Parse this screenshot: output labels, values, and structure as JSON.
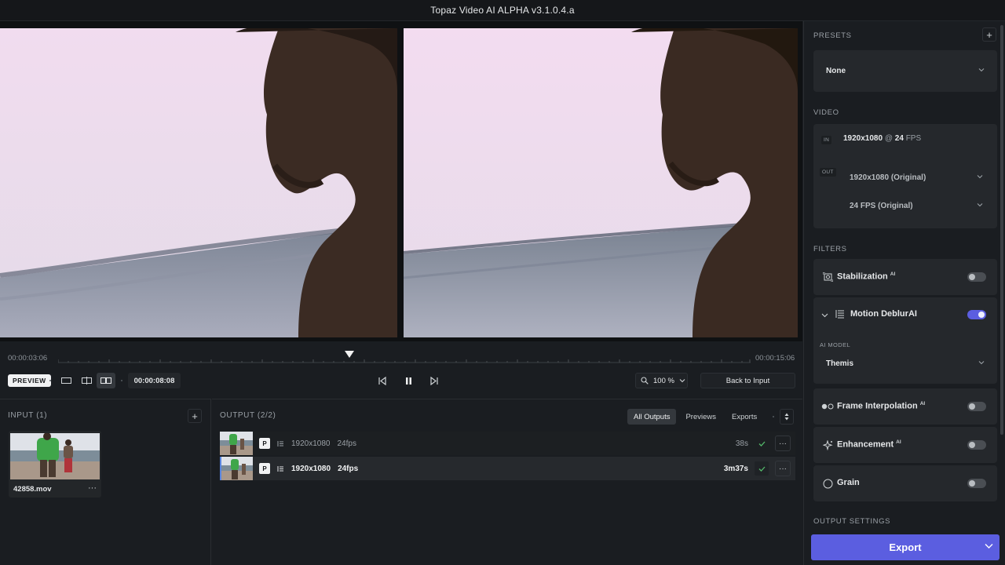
{
  "app": {
    "title": "Topaz Video AI ALPHA  v3.1.0.4.a"
  },
  "timeline": {
    "start_time": "00:00:03:06",
    "end_time": "00:00:15:06"
  },
  "transport": {
    "preview_label": "PREVIEW",
    "timecode": "00:00:08:08",
    "zoom_value": "100 %",
    "back_label": "Back to Input"
  },
  "input_panel": {
    "title": "INPUT (1)",
    "add_label": "+",
    "items": [
      {
        "name": "42858.mov",
        "more": "···"
      }
    ]
  },
  "output_panel": {
    "title": "OUTPUT (2/2)",
    "tabs": [
      "All Outputs",
      "Previews",
      "Exports"
    ],
    "rows": [
      {
        "badge": "P",
        "resolution": "1920x1080",
        "fps": "24fps",
        "duration": "38s",
        "more": "···"
      },
      {
        "badge": "P",
        "resolution": "1920x1080",
        "fps": "24fps",
        "duration": "3m37s",
        "more": "···"
      }
    ]
  },
  "sidebar": {
    "presets": {
      "title": "PRESETS",
      "add_label": "+",
      "value": "None"
    },
    "video": {
      "title": "VIDEO",
      "in_badge": "IN",
      "in_res": "1920x1080",
      "in_at": "@",
      "in_fps_num": "24",
      "in_fps_unit": "FPS",
      "out_badge": "OUT",
      "out_res": "1920x1080 (Original)",
      "out_fps": "24 FPS (Original)"
    },
    "filters": {
      "title": "FILTERS",
      "ai_tag": "AI",
      "stabilization": "Stabilization",
      "motion_deblur": "Motion Deblur",
      "ai_model_label": "AI MODEL",
      "ai_model_value": "Themis",
      "frame_interpolation": "Frame Interpolation",
      "enhancement": "Enhancement",
      "grain": "Grain",
      "toggles": {
        "stabilization": false,
        "motion_deblur": true,
        "frame_interpolation": false,
        "enhancement": false,
        "grain": false
      }
    },
    "output_settings": {
      "title": "OUTPUT SETTINGS"
    },
    "export_label": "Export"
  },
  "colors": {
    "accent": "#5b5ee0",
    "background": "#1a1d21",
    "panel": "#25282c"
  },
  "icons": {
    "zoom": "magnifier-icon",
    "prev": "step-back-icon",
    "play": "pause-icon",
    "next": "step-forward-icon",
    "check": "check-icon"
  }
}
